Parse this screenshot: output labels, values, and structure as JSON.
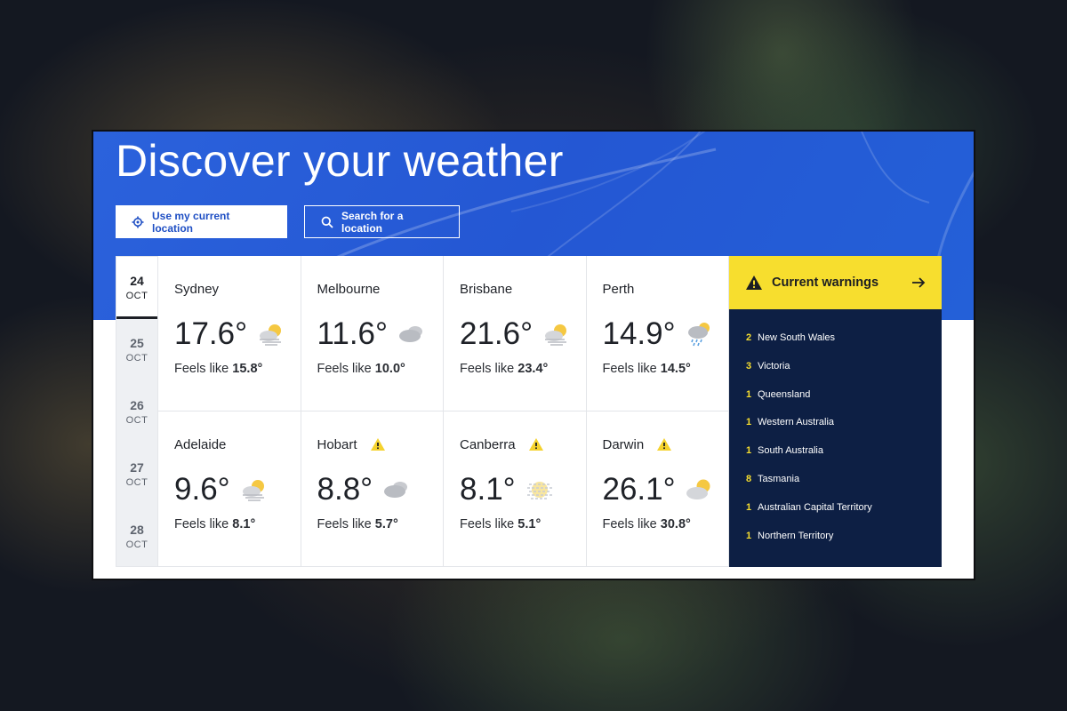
{
  "hero": {
    "title": "Discover your weather",
    "use_location_label": "Use my current location",
    "search_label": "Search for a location"
  },
  "dates": [
    {
      "day": "24",
      "month": "OCT",
      "active": true
    },
    {
      "day": "25",
      "month": "OCT",
      "active": false
    },
    {
      "day": "26",
      "month": "OCT",
      "active": false
    },
    {
      "day": "27",
      "month": "OCT",
      "active": false
    },
    {
      "day": "28",
      "month": "OCT",
      "active": false
    }
  ],
  "cities": [
    {
      "name": "Sydney",
      "temp": "17.6°",
      "feels_prefix": "Feels like ",
      "feels": "15.8°",
      "icon": "partly-cloudy-haze-icon",
      "warning": false
    },
    {
      "name": "Melbourne",
      "temp": "11.6°",
      "feels_prefix": "Feels like ",
      "feels": "10.0°",
      "icon": "cloudy-icon",
      "warning": false
    },
    {
      "name": "Brisbane",
      "temp": "21.6°",
      "feels_prefix": "Feels like ",
      "feels": "23.4°",
      "icon": "partly-cloudy-haze-icon",
      "warning": false
    },
    {
      "name": "Perth",
      "temp": "14.9°",
      "feels_prefix": "Feels like ",
      "feels": "14.5°",
      "icon": "showers-icon",
      "warning": false
    },
    {
      "name": "Adelaide",
      "temp": "9.6°",
      "feels_prefix": "Feels like ",
      "feels": "8.1°",
      "icon": "partly-cloudy-haze-icon",
      "warning": false
    },
    {
      "name": "Hobart",
      "temp": "8.8°",
      "feels_prefix": "Feels like ",
      "feels": "5.7°",
      "icon": "cloudy-icon",
      "warning": true
    },
    {
      "name": "Canberra",
      "temp": "8.1°",
      "feels_prefix": "Feels like ",
      "feels": "5.1°",
      "icon": "fog-sun-icon",
      "warning": true
    },
    {
      "name": "Darwin",
      "temp": "26.1°",
      "feels_prefix": "Feels like ",
      "feels": "30.8°",
      "icon": "partly-cloudy-icon",
      "warning": true
    }
  ],
  "warnings": {
    "title": "Current warnings",
    "items": [
      {
        "count": "2",
        "region": "New South Wales"
      },
      {
        "count": "3",
        "region": "Victoria"
      },
      {
        "count": "1",
        "region": "Queensland"
      },
      {
        "count": "1",
        "region": "Western Australia"
      },
      {
        "count": "1",
        "region": "South Australia"
      },
      {
        "count": "8",
        "region": "Tasmania"
      },
      {
        "count": "1",
        "region": "Australian Capital Territory"
      },
      {
        "count": "1",
        "region": "Northern Territory"
      }
    ]
  },
  "colors": {
    "hero_blue": "#2457d3",
    "warning_yellow": "#f7de2e",
    "warning_panel": "#0d1f44"
  }
}
